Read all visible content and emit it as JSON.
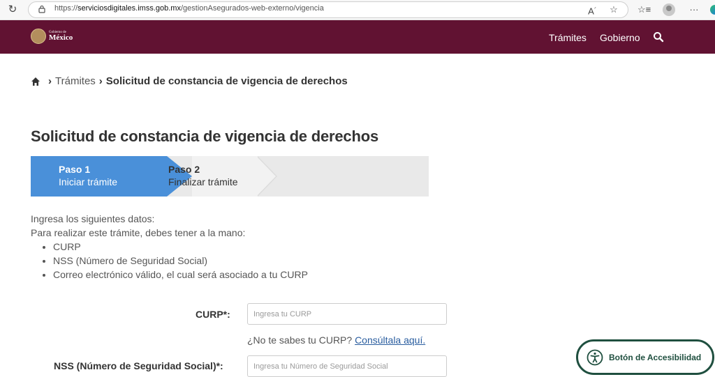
{
  "browser": {
    "url_prefix": "https://",
    "url_host": "serviciosdigitales.imss.gob.mx",
    "url_path": "/gestionAsegurados-web-externo/vigencia"
  },
  "header": {
    "logo_small": "Gobierno de",
    "logo_big": "México",
    "nav": [
      "Trámites",
      "Gobierno"
    ],
    "brand_color": "#611232"
  },
  "breadcrumb": {
    "items": [
      "Trámites",
      "Solicitud de constancia de vigencia de derechos"
    ]
  },
  "page_title": "Solicitud de constancia de vigencia de derechos",
  "steps": [
    {
      "title": "Paso 1",
      "subtitle": "Iniciar trámite",
      "active": true
    },
    {
      "title": "Paso 2",
      "subtitle": "Finalizar trámite",
      "active": false
    }
  ],
  "intro": {
    "line1": "Ingresa los siguientes datos:",
    "line2": "Para realizar este trámite, debes tener a la mano:",
    "items": [
      "CURP",
      "NSS (Número de Seguridad Social)",
      "Correo electrónico válido, el cual será asociado a tu CURP"
    ]
  },
  "form": {
    "curp_label": "CURP*:",
    "curp_placeholder": "Ingresa tu CURP",
    "curp_hint": "¿No te sabes tu CURP?",
    "curp_hint_link": "Consúltala aquí.",
    "nss_label": "NSS (Número de Seguridad Social)*:",
    "nss_placeholder": "Ingresa tu Número de Seguridad Social"
  },
  "accessibility_button": "Botón de Accesibilidad"
}
